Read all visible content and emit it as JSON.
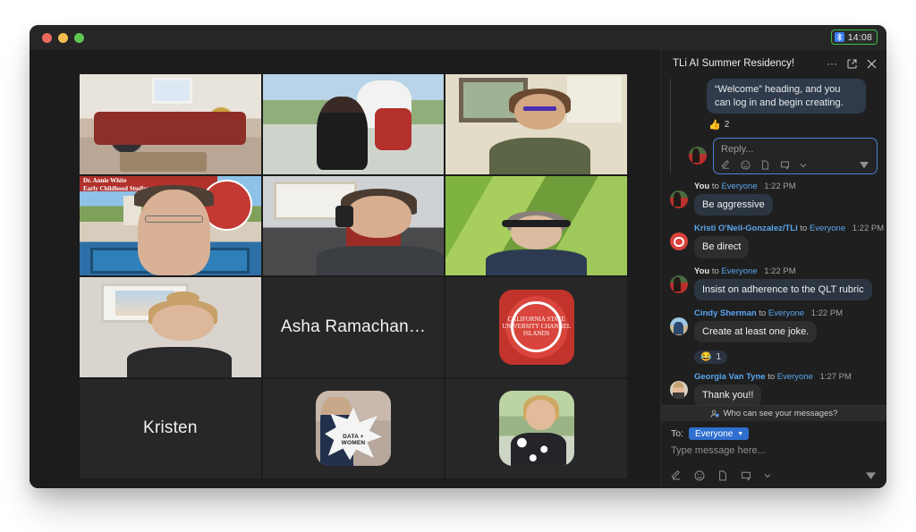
{
  "window": {
    "traffic_lights": [
      "close",
      "minimize",
      "zoom"
    ],
    "clock": "14:08",
    "clock_icon": "bluetooth-icon",
    "clock_border_color": "#3bbf4a"
  },
  "meeting": {
    "active_speaker_border_color": "#37d63f",
    "tiles": [
      {
        "id": "tile-1",
        "kind": "video",
        "scene": "conference-room",
        "label": "",
        "active": false
      },
      {
        "id": "tile-2",
        "kind": "video",
        "scene": "outdoor-mascot",
        "label": "",
        "active": false
      },
      {
        "id": "tile-3",
        "kind": "video",
        "scene": "office-window",
        "label": "",
        "active": false
      },
      {
        "id": "tile-4",
        "kind": "video",
        "scene": "campus-virtual-background",
        "label": "",
        "active": true,
        "overlay_line1": "Dr. Annie White",
        "overlay_line2": "Early Childhood Studies"
      },
      {
        "id": "tile-5",
        "kind": "video",
        "scene": "headset-gamer",
        "label": "",
        "active": false
      },
      {
        "id": "tile-6",
        "kind": "video",
        "scene": "grass-virtual-background",
        "label": "",
        "active": false
      },
      {
        "id": "tile-7",
        "kind": "video",
        "scene": "bedroom",
        "label": "",
        "active": false
      },
      {
        "id": "tile-8",
        "kind": "name",
        "label": "Asha Ramachan…",
        "active": false
      },
      {
        "id": "tile-9",
        "kind": "avatar",
        "avatar": "university-seal",
        "avatar_text": "CALIFORNIA STATE UNIVERSITY CHANNEL ISLANDS",
        "label": "",
        "active": false
      },
      {
        "id": "tile-10",
        "kind": "name",
        "label": "Kristen",
        "active": false
      },
      {
        "id": "tile-11",
        "kind": "avatar",
        "avatar": "data-plus-women-photo",
        "avatar_text": "DATA + WOMEN",
        "label": "",
        "active": false
      },
      {
        "id": "tile-12",
        "kind": "avatar",
        "avatar": "garden-portrait-photo",
        "label": "",
        "active": false
      }
    ]
  },
  "chat": {
    "title": "TLi AI Summer Residency!",
    "header_actions": [
      {
        "name": "more-options-icon",
        "glyph": "···"
      },
      {
        "name": "popout-icon",
        "glyph": "pop-out"
      },
      {
        "name": "close-icon",
        "glyph": "✕"
      }
    ],
    "thread": {
      "quoted_text": "“Welcome” heading, and you can log in and begin creating.",
      "reaction": {
        "emoji": "👍",
        "count": "2"
      },
      "reply_placeholder": "Reply...",
      "reply_tools": [
        "format-icon",
        "emoji-icon",
        "file-icon",
        "screenshot-icon",
        "chevron-down-icon"
      ],
      "send_icon": "send-icon"
    },
    "messages": [
      {
        "sender": "You",
        "is_you": true,
        "to_label": "to",
        "recipient": "Everyone",
        "time": "1:22 PM",
        "text": "Be aggressive",
        "avatar": "avatar-you",
        "reaction": null
      },
      {
        "sender": "Kristi O'Neil-Gonzalez/TLi",
        "is_you": false,
        "to_label": "to",
        "recipient": "Everyone",
        "time": "1:22 PM",
        "text": "Be direct",
        "avatar": "avatar-seal",
        "reaction": null
      },
      {
        "sender": "You",
        "is_you": true,
        "to_label": "to",
        "recipient": "Everyone",
        "time": "1:22 PM",
        "text": "Insist on adherence to the QLT rubric",
        "avatar": "avatar-you",
        "reaction": null
      },
      {
        "sender": "Cindy Sherman",
        "is_you": false,
        "to_label": "to",
        "recipient": "Everyone",
        "time": "1:22 PM",
        "text": "Create at least one joke.",
        "avatar": "avatar-cindy",
        "reaction": {
          "emoji": "😂",
          "count": "1"
        }
      },
      {
        "sender": "Georgia Van Tyne",
        "is_you": false,
        "to_label": "to",
        "recipient": "Everyone",
        "time": "1:27 PM",
        "text": "Thank you!!",
        "avatar": "avatar-georgia",
        "reaction": null,
        "actions": [
          "reply-icon",
          "react-icon",
          "more-icon"
        ]
      }
    ],
    "privacy_notice": "Who can see your messages?",
    "privacy_icon": "person-question-icon",
    "composer": {
      "to_label": "To:",
      "recipient": "Everyone",
      "recipient_chip_color": "#2f6fd0",
      "placeholder": "Type message here...",
      "tools": [
        "format-icon",
        "emoji-icon",
        "file-icon",
        "screenshot-icon",
        "chevron-down-icon"
      ],
      "send_icon": "send-icon"
    }
  }
}
